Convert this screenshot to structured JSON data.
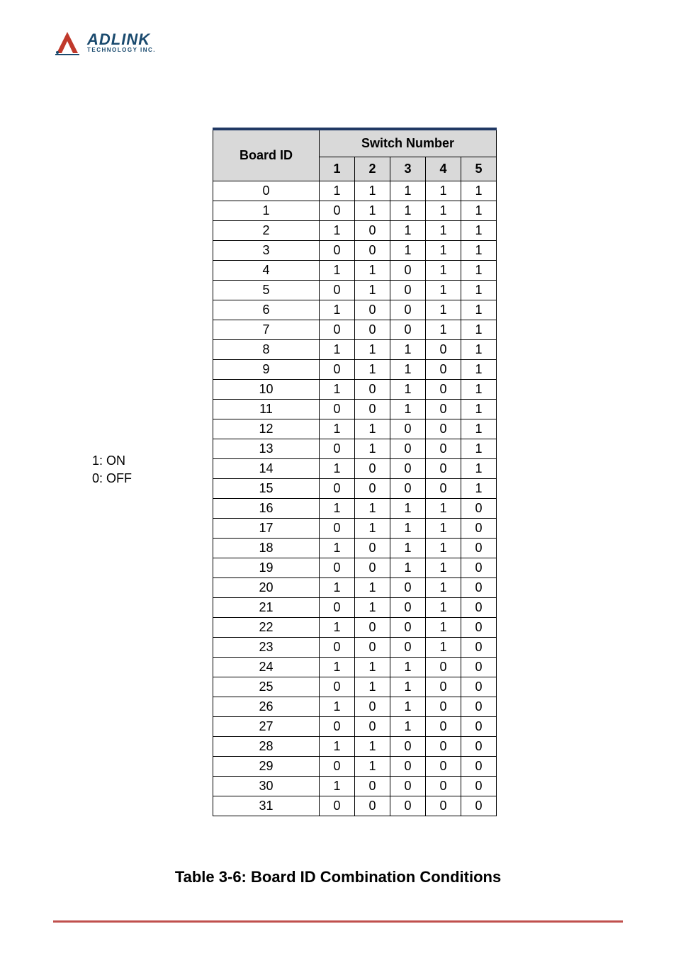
{
  "logo": {
    "name": "ADLINK",
    "subtitle": "TECHNOLOGY INC."
  },
  "legend": {
    "on": "1: ON",
    "off": "0: OFF"
  },
  "table": {
    "headers": {
      "board_id": "Board ID",
      "switch_number": "Switch Number",
      "cols": [
        "1",
        "2",
        "3",
        "4",
        "5"
      ]
    },
    "rows": [
      {
        "id": "0",
        "sw": [
          "1",
          "1",
          "1",
          "1",
          "1"
        ]
      },
      {
        "id": "1",
        "sw": [
          "0",
          "1",
          "1",
          "1",
          "1"
        ]
      },
      {
        "id": "2",
        "sw": [
          "1",
          "0",
          "1",
          "1",
          "1"
        ]
      },
      {
        "id": "3",
        "sw": [
          "0",
          "0",
          "1",
          "1",
          "1"
        ]
      },
      {
        "id": "4",
        "sw": [
          "1",
          "1",
          "0",
          "1",
          "1"
        ]
      },
      {
        "id": "5",
        "sw": [
          "0",
          "1",
          "0",
          "1",
          "1"
        ]
      },
      {
        "id": "6",
        "sw": [
          "1",
          "0",
          "0",
          "1",
          "1"
        ]
      },
      {
        "id": "7",
        "sw": [
          "0",
          "0",
          "0",
          "1",
          "1"
        ]
      },
      {
        "id": "8",
        "sw": [
          "1",
          "1",
          "1",
          "0",
          "1"
        ]
      },
      {
        "id": "9",
        "sw": [
          "0",
          "1",
          "1",
          "0",
          "1"
        ]
      },
      {
        "id": "10",
        "sw": [
          "1",
          "0",
          "1",
          "0",
          "1"
        ]
      },
      {
        "id": "11",
        "sw": [
          "0",
          "0",
          "1",
          "0",
          "1"
        ]
      },
      {
        "id": "12",
        "sw": [
          "1",
          "1",
          "0",
          "0",
          "1"
        ]
      },
      {
        "id": "13",
        "sw": [
          "0",
          "1",
          "0",
          "0",
          "1"
        ]
      },
      {
        "id": "14",
        "sw": [
          "1",
          "0",
          "0",
          "0",
          "1"
        ]
      },
      {
        "id": "15",
        "sw": [
          "0",
          "0",
          "0",
          "0",
          "1"
        ]
      },
      {
        "id": "16",
        "sw": [
          "1",
          "1",
          "1",
          "1",
          "0"
        ]
      },
      {
        "id": "17",
        "sw": [
          "0",
          "1",
          "1",
          "1",
          "0"
        ]
      },
      {
        "id": "18",
        "sw": [
          "1",
          "0",
          "1",
          "1",
          "0"
        ]
      },
      {
        "id": "19",
        "sw": [
          "0",
          "0",
          "1",
          "1",
          "0"
        ]
      },
      {
        "id": "20",
        "sw": [
          "1",
          "1",
          "0",
          "1",
          "0"
        ]
      },
      {
        "id": "21",
        "sw": [
          "0",
          "1",
          "0",
          "1",
          "0"
        ]
      },
      {
        "id": "22",
        "sw": [
          "1",
          "0",
          "0",
          "1",
          "0"
        ]
      },
      {
        "id": "23",
        "sw": [
          "0",
          "0",
          "0",
          "1",
          "0"
        ]
      },
      {
        "id": "24",
        "sw": [
          "1",
          "1",
          "1",
          "0",
          "0"
        ]
      },
      {
        "id": "25",
        "sw": [
          "0",
          "1",
          "1",
          "0",
          "0"
        ]
      },
      {
        "id": "26",
        "sw": [
          "1",
          "0",
          "1",
          "0",
          "0"
        ]
      },
      {
        "id": "27",
        "sw": [
          "0",
          "0",
          "1",
          "0",
          "0"
        ]
      },
      {
        "id": "28",
        "sw": [
          "1",
          "1",
          "0",
          "0",
          "0"
        ]
      },
      {
        "id": "29",
        "sw": [
          "0",
          "1",
          "0",
          "0",
          "0"
        ]
      },
      {
        "id": "30",
        "sw": [
          "1",
          "0",
          "0",
          "0",
          "0"
        ]
      },
      {
        "id": "31",
        "sw": [
          "0",
          "0",
          "0",
          "0",
          "0"
        ]
      }
    ]
  },
  "caption": "Table  3-6: Board ID Combination Conditions"
}
